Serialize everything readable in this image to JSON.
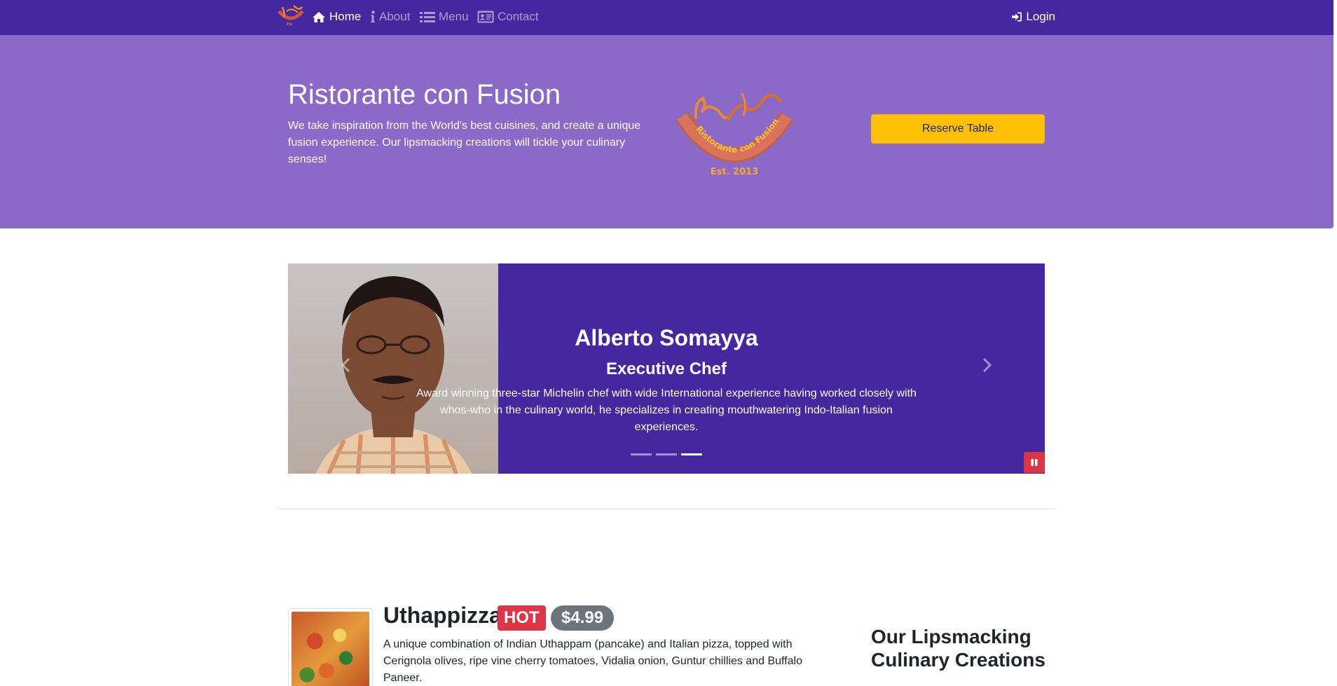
{
  "navbar": {
    "brand_icon": "restaurant-logo",
    "items": [
      {
        "label": "Home",
        "icon": "home-icon",
        "active": true
      },
      {
        "label": "About",
        "icon": "info-icon",
        "active": false
      },
      {
        "label": "Menu",
        "icon": "list-icon",
        "active": false
      },
      {
        "label": "Contact",
        "icon": "address-card-icon",
        "active": false
      }
    ],
    "login": {
      "label": "Login",
      "icon": "sign-in-icon"
    }
  },
  "jumbotron": {
    "title": "Ristorante con Fusion",
    "text": "We take inspiration from the World's best cuisines, and create a unique fusion experience. Our lipsmacking creations will tickle your culinary senses!",
    "logo": {
      "arc_text": "Ristorante con Fusion",
      "est_text": "Est. 2013"
    },
    "reserve_button": "Reserve Table"
  },
  "carousel": {
    "slide": {
      "name": "Alberto Somayya",
      "role": "Executive Chef",
      "description": "Award winning three-star Michelin chef with wide International experience having worked closely with whos-who in the culinary world, he specializes in creating mouthwatering Indo-Italian fusion experiences."
    },
    "indicators_count": 3,
    "active_indicator": 3,
    "prev_icon": "chevron-left-icon",
    "next_icon": "chevron-right-icon",
    "pause_icon": "pause-icon"
  },
  "featured": {
    "name": "Uthappizza",
    "badge": "HOT",
    "price": "$4.99",
    "description": "A unique combination of Indian Uthappam (pancake) and Italian pizza, topped with Cerignola olives, ripe vine cherry tomatoes, Vidalia onion, Guntur chillies and Buffalo Paneer."
  },
  "sidebar": {
    "title": "Our Lipsmacking Culinary Creations"
  },
  "colors": {
    "navbar": "#4527a0",
    "jumbotron": "#8b69c9",
    "carousel": "#4527a0",
    "reserve_button": "#ffc107",
    "badge_hot": "#dc3545",
    "badge_price": "#6c757d",
    "pause_button": "#dc3545"
  }
}
